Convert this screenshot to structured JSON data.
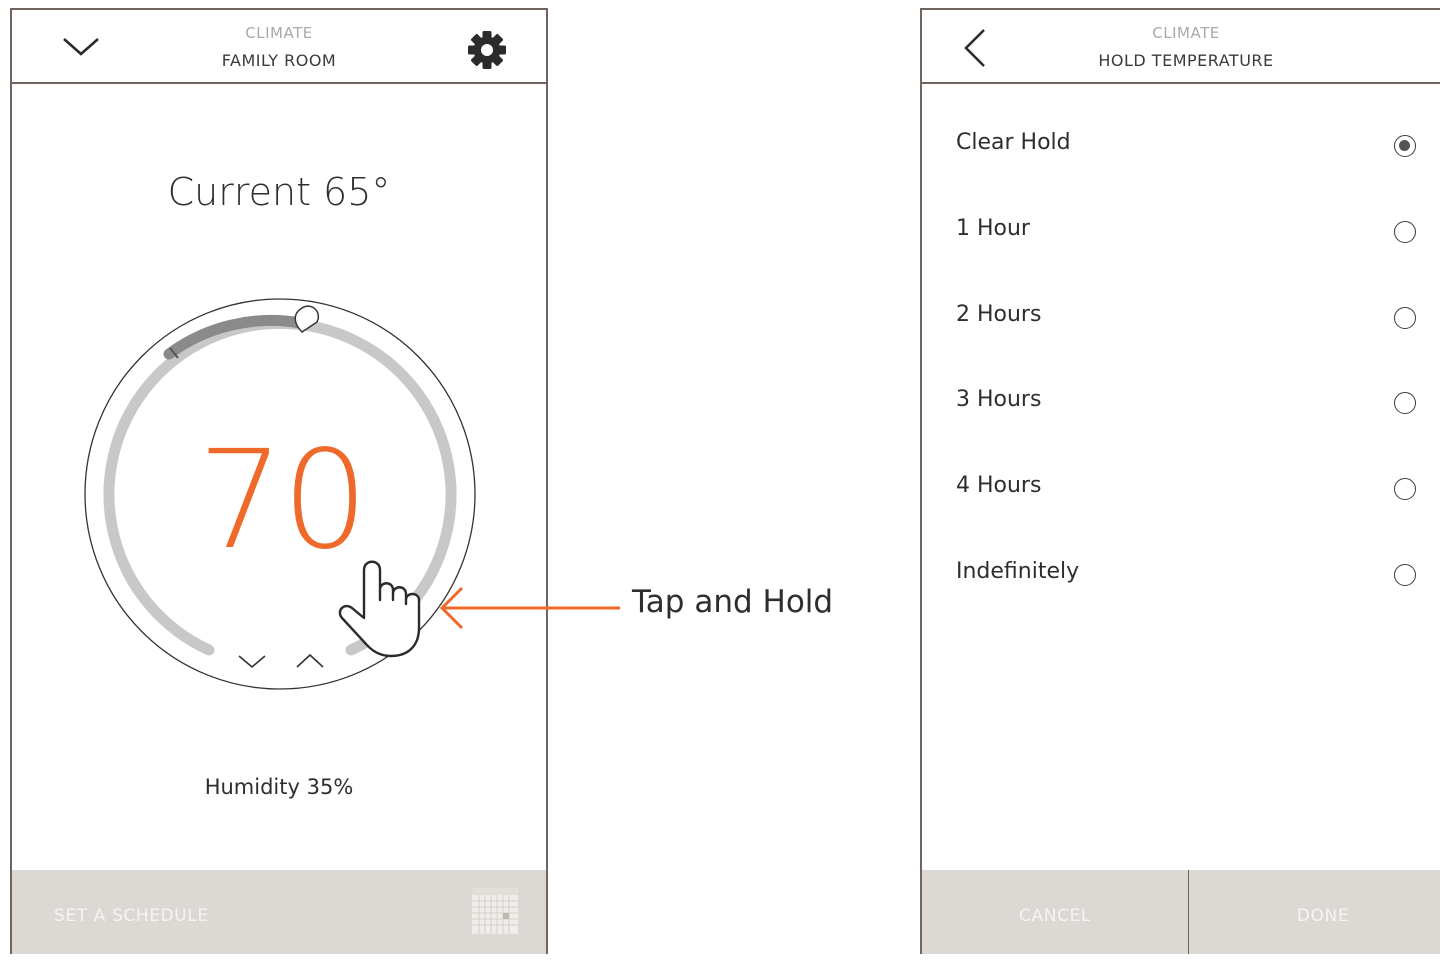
{
  "left_screen": {
    "header": {
      "kicker": "CLIMATE",
      "title": "FAMILY ROOM",
      "left_icon": "chevron-down-icon",
      "right_icon": "gear-icon"
    },
    "current": "Current 65°",
    "setpoint": "70",
    "humidity": "Humidity 35%",
    "footer": {
      "label": "SET A SCHEDULE",
      "icon": "calendar-icon"
    }
  },
  "callout": {
    "text": "Tap and Hold",
    "hint_icon": "hand-pointer-icon"
  },
  "right_screen": {
    "header": {
      "kicker": "CLIMATE",
      "title": "HOLD TEMPERATURE",
      "left_icon": "chevron-left-icon"
    },
    "options": [
      {
        "label": "Clear Hold",
        "selected": true
      },
      {
        "label": "1 Hour",
        "selected": false
      },
      {
        "label": "2 Hours",
        "selected": false
      },
      {
        "label": "3 Hours",
        "selected": false
      },
      {
        "label": "4 Hours",
        "selected": false
      },
      {
        "label": "Indefinitely",
        "selected": false
      }
    ],
    "footer": {
      "cancel": "CANCEL",
      "done": "DONE"
    }
  },
  "colors": {
    "accent": "#ef6a2a",
    "frame": "#6f655e",
    "footer_bg": "#dcd9d5",
    "dial_track": "#c8c8c8",
    "dial_active": "#8a8a8a"
  }
}
